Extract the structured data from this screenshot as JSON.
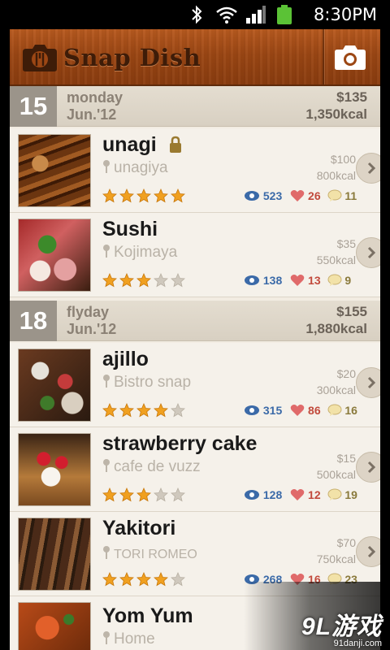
{
  "status_bar": {
    "time": "8:30PM"
  },
  "app": {
    "title": "Snap Dish"
  },
  "days": [
    {
      "num": "15",
      "day_name": "monday",
      "date": "Jun.'12",
      "total_price": "$135",
      "total_kcal": "1,350kcal"
    },
    {
      "num": "18",
      "day_name": "flyday",
      "date": "Jun.'12",
      "total_price": "$155",
      "total_kcal": "1,880kcal"
    }
  ],
  "dishes": [
    {
      "name": "unagi",
      "place": "unagiya",
      "price": "$100",
      "kcal": "800kcal",
      "rating": 5,
      "views": "523",
      "likes": "26",
      "comments": "11",
      "locked": true
    },
    {
      "name": "Sushi",
      "place": "Kojimaya",
      "price": "$35",
      "kcal": "550kcal",
      "rating": 3,
      "views": "138",
      "likes": "13",
      "comments": "9"
    },
    {
      "name": "ajillo",
      "place": "Bistro snap",
      "price": "$20",
      "kcal": "300kcal",
      "rating": 4,
      "views": "315",
      "likes": "86",
      "comments": "16"
    },
    {
      "name": "strawberry cake",
      "place": "cafe de vuzz",
      "price": "$15",
      "kcal": "500kcal",
      "rating": 3,
      "views": "128",
      "likes": "12",
      "comments": "19"
    },
    {
      "name": "Yakitori",
      "place": "TORI ROMEO",
      "price": "$70",
      "kcal": "750kcal",
      "rating": 4,
      "views": "268",
      "likes": "16",
      "comments": "23"
    },
    {
      "name": "Yom Yum",
      "place": "Home"
    }
  ],
  "watermark": {
    "logo": "9L游戏",
    "url": "91danji.com"
  },
  "colors": {
    "header_wood": "#9c4714",
    "star_on": "#f0a020",
    "star_off": "#cfc8bd",
    "views": "#3b6aa8",
    "likes": "#c24a3c",
    "comments": "#8a7a3c"
  }
}
